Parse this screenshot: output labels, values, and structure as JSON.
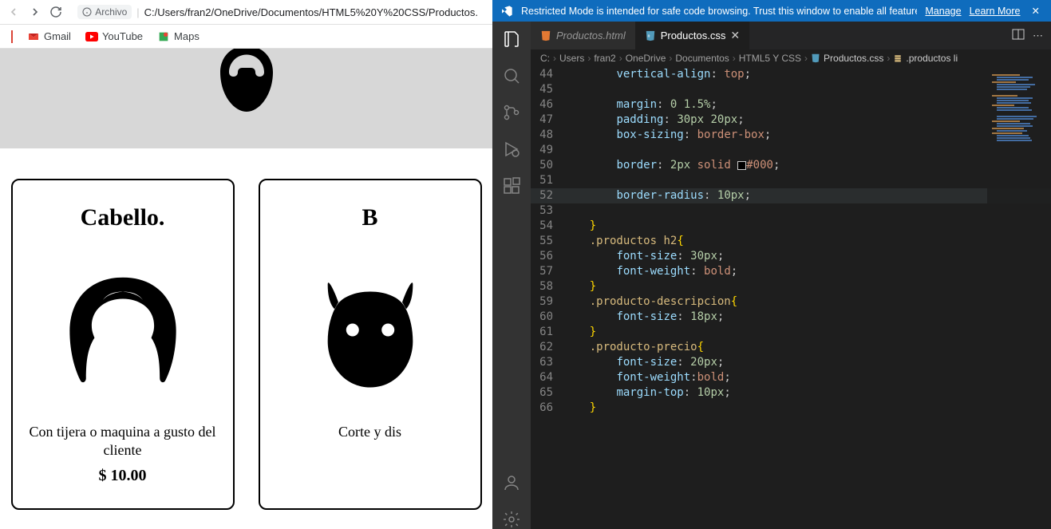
{
  "browser": {
    "url_label": "Archivo",
    "url_path": "C:/Users/fran2/OneDrive/Documentos/HTML5%20Y%20CSS/Productos.",
    "bookmarks": [
      {
        "label": "Gmail"
      },
      {
        "label": "YouTube"
      },
      {
        "label": "Maps"
      }
    ],
    "cards": [
      {
        "title": "Cabello.",
        "desc": "Con tijera o maquina a gusto del cliente",
        "price": "$ 10.00"
      },
      {
        "title": "B",
        "desc": "Corte y dis",
        "price": ""
      }
    ]
  },
  "vscode": {
    "banner": {
      "message": "Restricted Mode is intended for safe code browsing. Trust this window to enable all features.",
      "manage": "Manage",
      "learn": "Learn More"
    },
    "tabs": [
      {
        "label": "Productos.html",
        "active": false
      },
      {
        "label": "Productos.css",
        "active": true
      }
    ],
    "breadcrumbs": [
      "C:",
      "Users",
      "fran2",
      "OneDrive",
      "Documentos",
      "HTML5 Y CSS",
      "Productos.css",
      ".productos li"
    ],
    "code": [
      {
        "n": 44,
        "html": "        <span class='tok-prop'>vertical-align</span><span class='tok-punc'>:</span> <span class='tok-kw'>top</span><span class='tok-punc'>;</span>"
      },
      {
        "n": 45,
        "html": ""
      },
      {
        "n": 46,
        "html": "        <span class='tok-prop'>margin</span><span class='tok-punc'>:</span> <span class='tok-num'>0</span> <span class='tok-num'>1.5%</span><span class='tok-punc'>;</span>"
      },
      {
        "n": 47,
        "html": "        <span class='tok-prop'>padding</span><span class='tok-punc'>:</span> <span class='tok-num'>30px</span> <span class='tok-num'>20px</span><span class='tok-punc'>;</span>"
      },
      {
        "n": 48,
        "html": "        <span class='tok-prop'>box-sizing</span><span class='tok-punc'>:</span> <span class='tok-kw'>border-box</span><span class='tok-punc'>;</span>"
      },
      {
        "n": 49,
        "html": ""
      },
      {
        "n": 50,
        "html": "        <span class='tok-prop'>border</span><span class='tok-punc'>:</span> <span class='tok-num'>2px</span> <span class='tok-kw'>solid</span> <span class='color-sw'></span><span class='tok-kw'>#000</span><span class='tok-punc'>;</span>"
      },
      {
        "n": 51,
        "html": ""
      },
      {
        "n": 52,
        "hl": true,
        "html": "        <span class='tok-prop'>border-radius</span><span class='tok-punc'>:</span> <span class='tok-num'>10px</span><span class='tok-punc'>;</span>"
      },
      {
        "n": 53,
        "html": ""
      },
      {
        "n": 54,
        "html": "    <span class='tok-brace'>}</span>"
      },
      {
        "n": 55,
        "html": "    <span class='tok-sel'>.productos</span> <span class='tok-sel'>h2</span><span class='tok-brace'>{</span>"
      },
      {
        "n": 56,
        "html": "        <span class='tok-prop'>font-size</span><span class='tok-punc'>:</span> <span class='tok-num'>30px</span><span class='tok-punc'>;</span>"
      },
      {
        "n": 57,
        "html": "        <span class='tok-prop'>font-weight</span><span class='tok-punc'>:</span> <span class='tok-kw'>bold</span><span class='tok-punc'>;</span>"
      },
      {
        "n": 58,
        "html": "    <span class='tok-brace'>}</span>"
      },
      {
        "n": 59,
        "html": "    <span class='tok-sel'>.producto-descripcion</span><span class='tok-brace'>{</span>"
      },
      {
        "n": 60,
        "html": "        <span class='tok-prop'>font-size</span><span class='tok-punc'>:</span> <span class='tok-num'>18px</span><span class='tok-punc'>;</span>"
      },
      {
        "n": 61,
        "html": "    <span class='tok-brace'>}</span>"
      },
      {
        "n": 62,
        "html": "    <span class='tok-sel'>.producto-precio</span><span class='tok-brace'>{</span>"
      },
      {
        "n": 63,
        "html": "        <span class='tok-prop'>font-size</span><span class='tok-punc'>:</span> <span class='tok-num'>20px</span><span class='tok-punc'>;</span>"
      },
      {
        "n": 64,
        "html": "        <span class='tok-prop'>font-weight</span><span class='tok-punc'>:</span><span class='tok-kw'>bold</span><span class='tok-punc'>;</span>"
      },
      {
        "n": 65,
        "html": "        <span class='tok-prop'>margin-top</span><span class='tok-punc'>:</span> <span class='tok-num'>10px</span><span class='tok-punc'>;</span>"
      },
      {
        "n": 66,
        "html": "    <span class='tok-brace'>}</span>"
      }
    ]
  }
}
